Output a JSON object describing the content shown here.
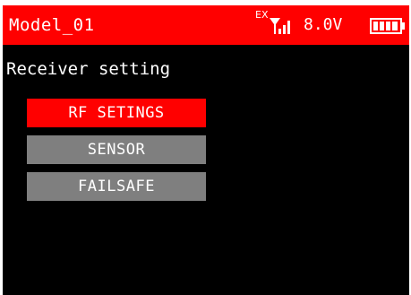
{
  "header": {
    "model_name": "Model_01",
    "telemetry_tag": "EX",
    "signal_icon": "signal-bars-icon",
    "voltage": "8.0V",
    "battery_icon": "battery-icon",
    "battery_level": 1.0
  },
  "page": {
    "heading": "Receiver setting"
  },
  "menu": {
    "items": [
      {
        "label": "RF SETINGS",
        "selected": true
      },
      {
        "label": "SENSOR",
        "selected": false
      },
      {
        "label": "FAILSAFE",
        "selected": false
      }
    ]
  },
  "colors": {
    "titlebar": "#ff0000",
    "background": "#000000",
    "selected_item": "#ff0000",
    "unselected_item": "#7f7f7f",
    "text": "#ffffff"
  }
}
